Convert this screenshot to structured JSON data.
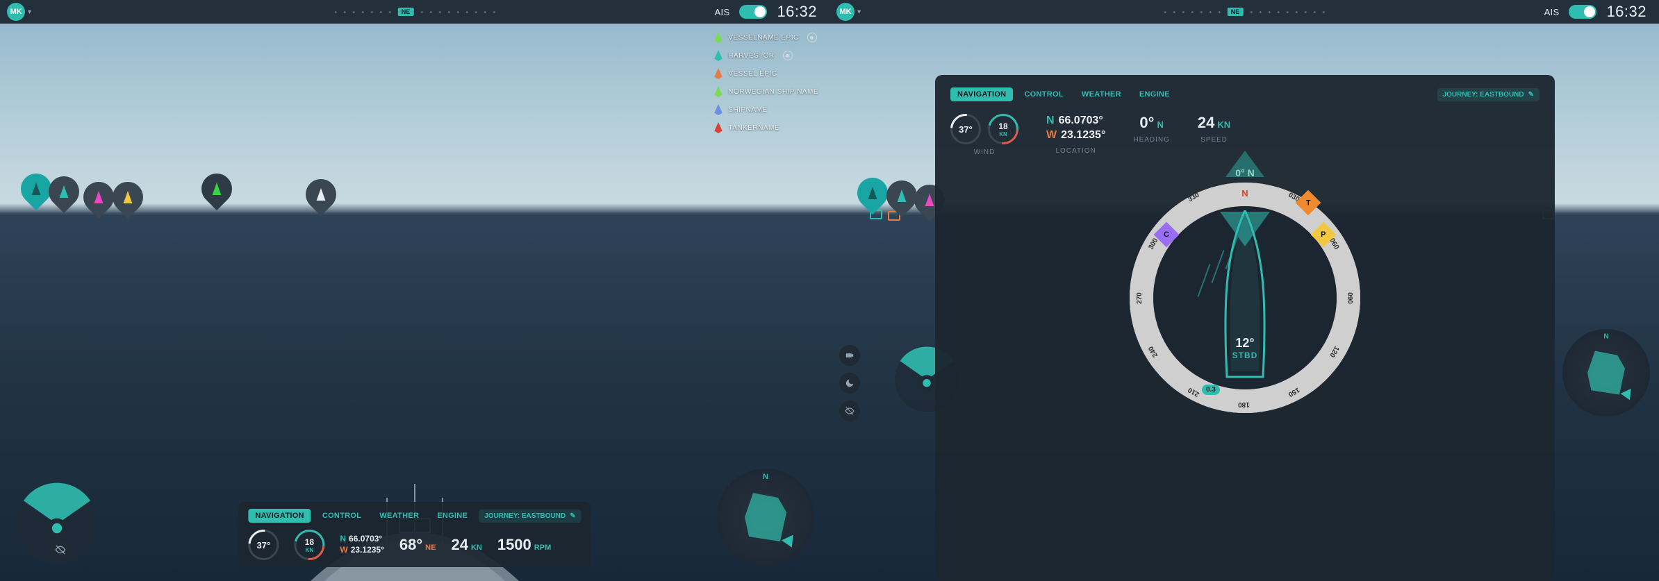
{
  "topbar": {
    "avatar_initials": "MK",
    "ais_label": "AIS",
    "time": "16:32",
    "compass_badge": "NE"
  },
  "vessel_list": [
    {
      "label": "VESSELNAME EPIC",
      "color": "#7ed957",
      "pin": true
    },
    {
      "label": "HARVESTOR",
      "color": "#2fbdb0",
      "pin": true
    },
    {
      "label": "VESSEL EPIC",
      "color": "#e87b45",
      "pin": false
    },
    {
      "label": "NORWEGIAN SHIP NAME",
      "color": "#7ed957",
      "pin": false
    },
    {
      "label": "SHIPNAME",
      "color": "#6d8fe0",
      "pin": false
    },
    {
      "label": "TANKERNAME",
      "color": "#d94234",
      "pin": false
    }
  ],
  "tabs": {
    "navigation": "NAVIGATION",
    "control": "CONTROL",
    "weather": "WEATHER",
    "engine": "ENGINE",
    "journey": "JOURNEY: EASTBOUND"
  },
  "nav": {
    "wind_deg": "37°",
    "wind_kn": "18",
    "wind_kn_unit": "KN",
    "wind_label": "WIND",
    "lat_dir": "N",
    "lat_val": "66.0703°",
    "lon_dir": "W",
    "lon_val": "23.1235°",
    "location_label": "LOCATION",
    "heading_val": "0°",
    "heading_dir": "N",
    "heading_label": "HEADING",
    "speed_val": "24",
    "speed_unit": "KN",
    "speed_label": "SPEED"
  },
  "bottom_small": {
    "temp_val": "68°",
    "temp_dir": "NE",
    "speed_val": "24",
    "speed_unit": "KN",
    "rpm_val": "1500",
    "rpm_unit": "RPM"
  },
  "compass": {
    "zero": "0° N",
    "stbd_deg": "12°",
    "stbd_txt": "STBD",
    "depth": "0.3",
    "n": "N",
    "ticks": [
      "000",
      "030",
      "060",
      "090",
      "120",
      "150",
      "180",
      "210",
      "240",
      "270",
      "300",
      "330"
    ],
    "marker_t": "T",
    "marker_p": "P",
    "marker_c": "C"
  },
  "icons": {
    "edit": "✎",
    "camera": "●",
    "moon": "☾",
    "eye_off": "⦸"
  }
}
